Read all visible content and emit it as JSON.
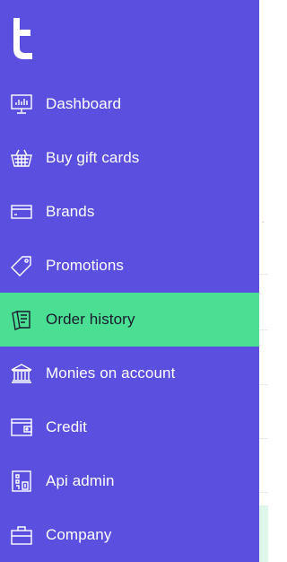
{
  "app": {
    "brand_color": "#5b4fe0",
    "active_color": "#4adf93",
    "logo": "t-logo"
  },
  "sidebar": {
    "active_index": 4,
    "items": [
      {
        "label": "Dashboard",
        "icon": "monitor-chart-icon"
      },
      {
        "label": "Buy gift cards",
        "icon": "basket-icon"
      },
      {
        "label": "Brands",
        "icon": "card-icon"
      },
      {
        "label": "Promotions",
        "icon": "tag-icon"
      },
      {
        "label": "Order history",
        "icon": "receipt-stack-icon"
      },
      {
        "label": "Monies on account",
        "icon": "bank-icon"
      },
      {
        "label": "Credit",
        "icon": "wallet-icon"
      },
      {
        "label": "Api admin",
        "icon": "api-building-icon"
      },
      {
        "label": "Company",
        "icon": "briefcase-icon"
      }
    ]
  }
}
